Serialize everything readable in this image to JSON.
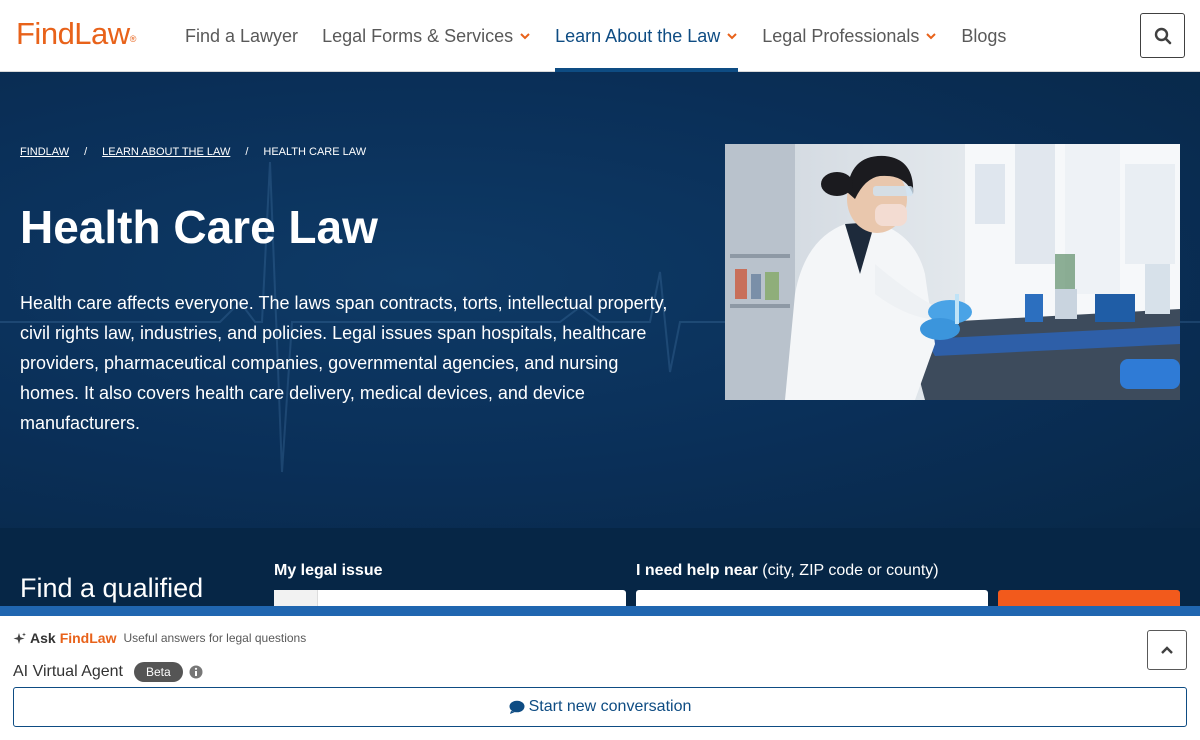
{
  "header": {
    "logo": "FindLaw",
    "logo_mark": "®",
    "nav": [
      {
        "label": "Find a Lawyer",
        "dropdown": false,
        "active": false
      },
      {
        "label": "Legal Forms & Services",
        "dropdown": true,
        "active": false
      },
      {
        "label": "Learn About the Law",
        "dropdown": true,
        "active": true
      },
      {
        "label": "Legal Professionals",
        "dropdown": true,
        "active": false
      },
      {
        "label": "Blogs",
        "dropdown": false,
        "active": false
      }
    ],
    "search_icon": "search-icon"
  },
  "breadcrumb": [
    "FINDLAW",
    "LEARN ABOUT THE LAW",
    "HEALTH CARE LAW"
  ],
  "breadcrumb_separator": "/",
  "hero": {
    "title": "Health Care Law",
    "description": "Health care affects everyone. The laws span contracts, torts, intellectual property, civil rights law, industries, and policies. Legal issues span hospitals, healthcare providers, pharmaceutical companies, governmental agencies, and nursing homes. It also covers health care delivery, medical devices, and device manufacturers."
  },
  "finder": {
    "title": "Find a qualified",
    "issue_label": "My legal issue",
    "near_label_bold": "I need help near",
    "near_label_hint": " (city, ZIP code or county)"
  },
  "ask_panel": {
    "ask_word": "Ask",
    "brand": "FindLaw",
    "subtitle": "Useful answers for legal questions",
    "agent_name": "AI Virtual Agent",
    "beta": "Beta",
    "start_button": "Start new conversation"
  },
  "colors": {
    "brand_orange": "#e8621a",
    "nav_blue": "#0e4c83",
    "hero_navy": "#0a2f58",
    "panel_blue": "#2066b0"
  }
}
